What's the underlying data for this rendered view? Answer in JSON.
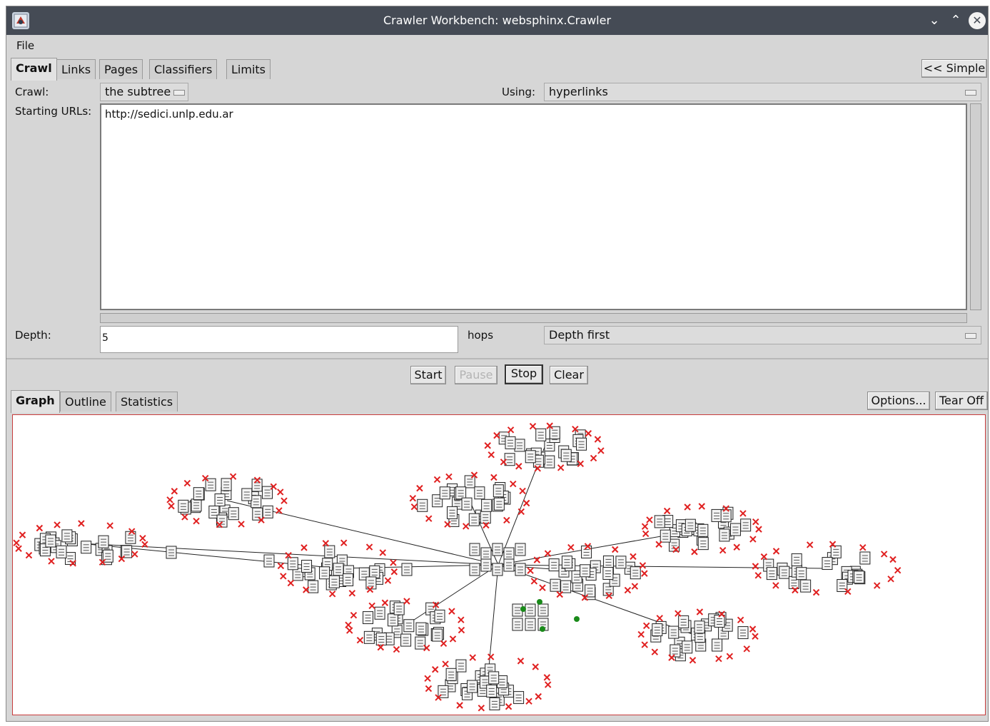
{
  "window": {
    "title": "Crawler Workbench: websphinx.Crawler",
    "minimize_glyph": "⌄",
    "maximize_glyph": "⌃",
    "close_glyph": "✕"
  },
  "menubar": {
    "items": [
      {
        "label": "File"
      }
    ]
  },
  "top_tabs": [
    {
      "label": "Crawl",
      "selected": true
    },
    {
      "label": "Links",
      "selected": false
    },
    {
      "label": "Pages",
      "selected": false
    },
    {
      "label": "Classifiers",
      "selected": false
    },
    {
      "label": "Limits",
      "selected": false
    }
  ],
  "simple_button": "<< Simple",
  "crawl_form": {
    "crawl_label": "Crawl:",
    "crawl_value": "the subtree",
    "using_label": "Using:",
    "using_value": "hyperlinks",
    "starting_urls_label": "Starting URLs:",
    "starting_urls_value": "http://sedici.unlp.edu.ar",
    "depth_label": "Depth:",
    "depth_value": "5",
    "hops_label": "hops",
    "search_order_value": "Depth first"
  },
  "actions": {
    "start": "Start",
    "pause": "Pause",
    "stop": "Stop",
    "clear": "Clear"
  },
  "view_tabs": [
    {
      "label": "Graph",
      "selected": true
    },
    {
      "label": "Outline",
      "selected": false
    },
    {
      "label": "Statistics",
      "selected": false
    }
  ],
  "view_buttons": {
    "options": "Options...",
    "tear_off": "Tear Off"
  },
  "graph": {
    "clusters": [
      {
        "name": "cluster-left-far"
      },
      {
        "name": "cluster-upper-left"
      },
      {
        "name": "cluster-center-left"
      },
      {
        "name": "cluster-upper-center"
      },
      {
        "name": "cluster-top"
      },
      {
        "name": "cluster-right-upper"
      },
      {
        "name": "cluster-right-far"
      },
      {
        "name": "cluster-center-right"
      },
      {
        "name": "cluster-lower-right"
      },
      {
        "name": "cluster-lower-center"
      },
      {
        "name": "cluster-bottom"
      }
    ],
    "colors": {
      "link": "#222222",
      "error_marker": "#e02020",
      "pending_marker": "#1a8a1a",
      "page_icon": "#f4f4f4"
    }
  }
}
